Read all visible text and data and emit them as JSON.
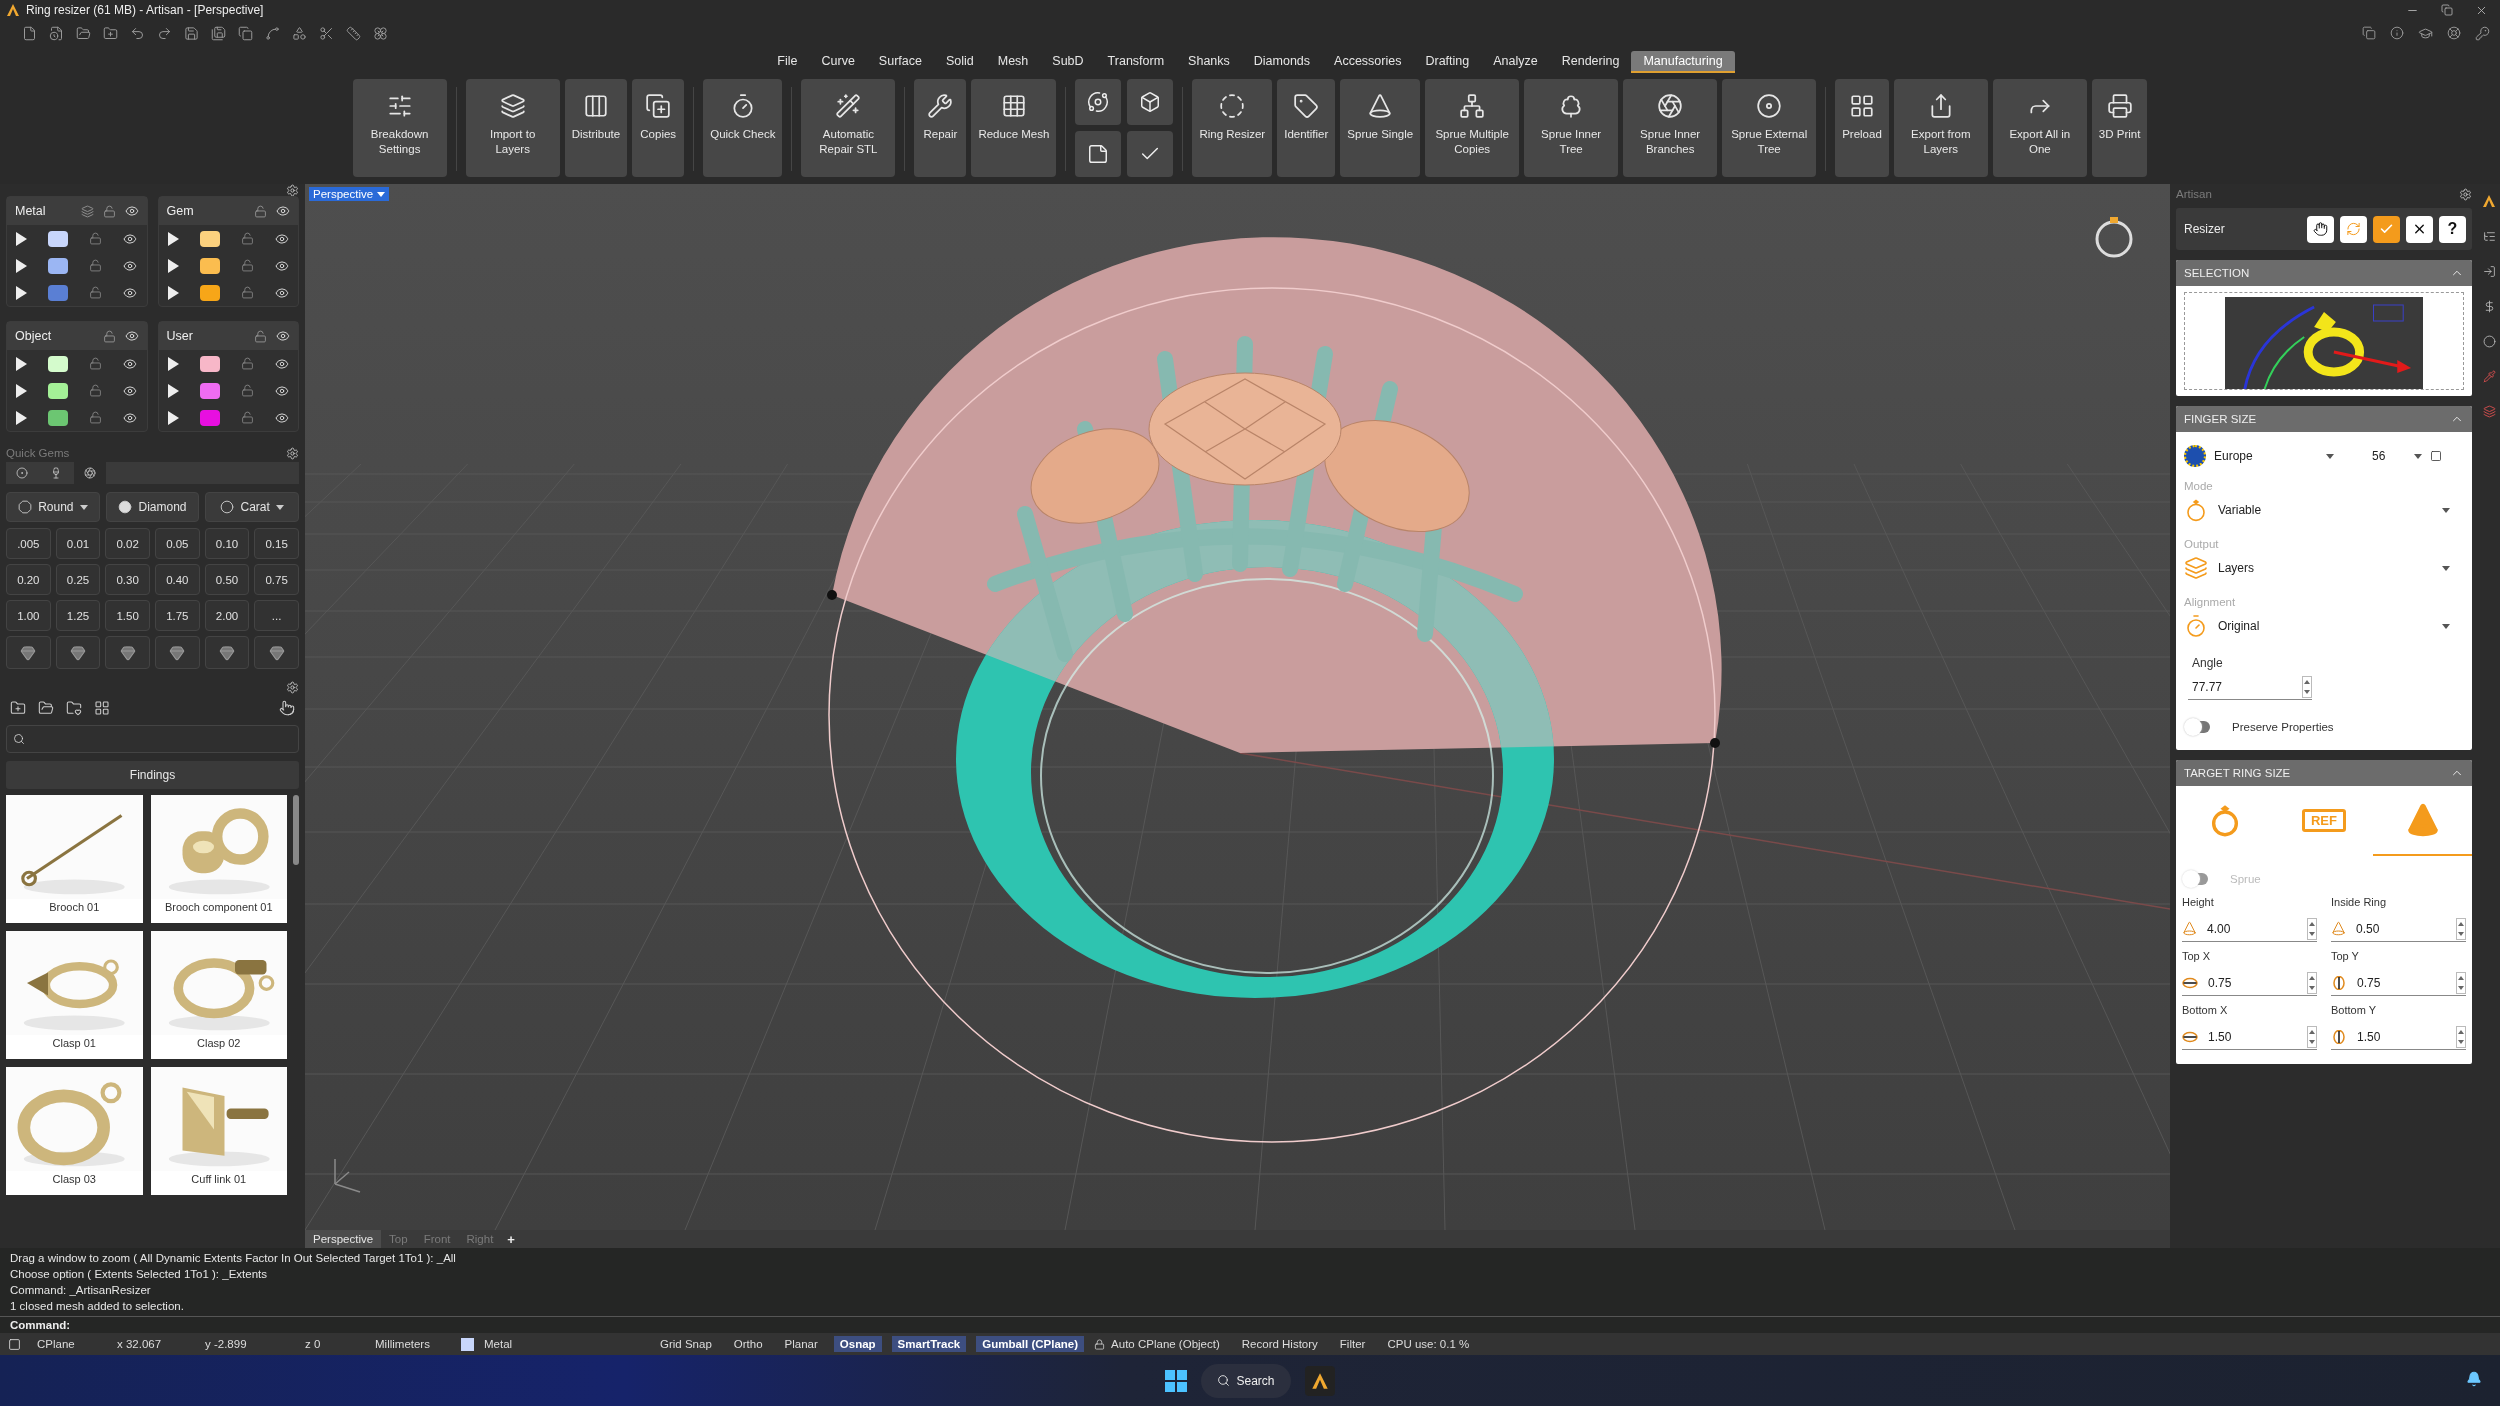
{
  "window": {
    "title": "Ring resizer (61 MB) - Artisan - [Perspective]"
  },
  "menu": [
    {
      "label": "File",
      "selected": false
    },
    {
      "label": "Curve",
      "selected": false
    },
    {
      "label": "Surface",
      "selected": false
    },
    {
      "label": "Solid",
      "selected": false
    },
    {
      "label": "Mesh",
      "selected": false
    },
    {
      "label": "SubD",
      "selected": false
    },
    {
      "label": "Transform",
      "selected": false
    },
    {
      "label": "Shanks",
      "selected": false
    },
    {
      "label": "Diamonds",
      "selected": false
    },
    {
      "label": "Accessories",
      "selected": false
    },
    {
      "label": "Drafting",
      "selected": false
    },
    {
      "label": "Analyze",
      "selected": false
    },
    {
      "label": "Rendering",
      "selected": false
    },
    {
      "label": "Manufacturing",
      "selected": true
    }
  ],
  "ribbon": {
    "groups": [
      {
        "kind": "large",
        "buttons": [
          "Breakdown Settings"
        ]
      },
      {
        "kind": "large",
        "buttons": [
          "Import to Layers",
          "Distribute",
          "Copies"
        ]
      },
      {
        "kind": "large",
        "buttons": [
          "Quick Check"
        ]
      },
      {
        "kind": "large",
        "buttons": [
          "Automatic Repair STL"
        ]
      },
      {
        "kind": "large",
        "buttons": [
          "Repair",
          "Reduce Mesh"
        ]
      },
      {
        "kind": "small"
      },
      {
        "kind": "large",
        "buttons": [
          "Ring Resizer",
          "Identifier",
          "Sprue Single",
          "Sprue Multiple Copies",
          "Sprue Inner Tree",
          "Sprue Inner Branches",
          "Sprue External Tree"
        ]
      },
      {
        "kind": "large",
        "buttons": [
          "Preload",
          "Export from Layers",
          "Export All in One",
          "3D Print"
        ]
      }
    ]
  },
  "layers": [
    {
      "name": "Metal",
      "swatches": [
        {
          "color": "#c8d6fb"
        },
        {
          "color": "#9bb6f3"
        },
        {
          "color": "#5a7fd4"
        }
      ]
    },
    {
      "name": "Gem",
      "swatches": [
        {
          "color": "#fcd17e"
        },
        {
          "color": "#fbbd4f"
        },
        {
          "color": "#f7a618"
        }
      ]
    },
    {
      "name": "Object",
      "swatches": [
        {
          "color": "#d4fbcc"
        },
        {
          "color": "#a4f197"
        },
        {
          "color": "#6cc672"
        }
      ]
    },
    {
      "name": "User",
      "swatches": [
        {
          "color": "#f7b7c8"
        },
        {
          "color": "#ef6cf2"
        },
        {
          "color": "#e80fe0"
        }
      ]
    }
  ],
  "quick_gems": {
    "title": "Quick Gems",
    "tabs": [
      {
        "selected": false
      },
      {
        "selected": false
      },
      {
        "selected": true
      }
    ],
    "dropdowns": [
      "Round",
      "Diamond",
      "Carat"
    ],
    "sizes": [
      ".005",
      "0.01",
      "0.02",
      "0.05",
      "0.10",
      "0.15",
      "0.20",
      "0.25",
      "0.30",
      "0.40",
      "0.50",
      "0.75",
      "1.00",
      "1.25",
      "1.50",
      "1.75",
      "2.00",
      "..."
    ]
  },
  "findings": {
    "category": "Findings",
    "items": [
      {
        "caption": "Brooch 01"
      },
      {
        "caption": "Brooch component 01"
      },
      {
        "caption": "Clasp 01"
      },
      {
        "caption": "Clasp 02"
      },
      {
        "caption": "Clasp 03"
      },
      {
        "caption": "Cuff link 01"
      }
    ]
  },
  "viewport": {
    "label": "Perspective",
    "tabs": [
      {
        "label": "Perspective",
        "selected": true
      },
      {
        "label": "Top",
        "selected": false
      },
      {
        "label": "Front",
        "selected": false
      },
      {
        "label": "Right",
        "selected": false
      }
    ],
    "add": "+"
  },
  "plugin": {
    "title": "Artisan",
    "tool": "Resizer",
    "help": "?"
  },
  "selection": {
    "title": "SELECTION"
  },
  "finger_size": {
    "title": "FINGER SIZE",
    "region": "Europe",
    "size": "56",
    "fields": [
      {
        "label": "Mode",
        "value": "Variable"
      },
      {
        "label": "Output",
        "value": "Layers"
      },
      {
        "label": "Alignment",
        "value": "Original"
      }
    ],
    "angle": {
      "label": "Angle",
      "value": "77.77"
    },
    "preserve_properties": {
      "label": "Preserve Properties",
      "on": false
    }
  },
  "target_ring_size": {
    "title": "TARGET RING SIZE",
    "tabs": [
      {
        "selected": false
      },
      {
        "label": "REF",
        "selected": false
      },
      {
        "selected": true
      }
    ],
    "sprue": {
      "label": "Sprue",
      "on": false,
      "disabled": true
    },
    "fields": [
      {
        "label": "Height",
        "value": "4.00"
      },
      {
        "label": "Inside Ring",
        "value": "0.50"
      },
      {
        "label": "Top X",
        "value": "0.75"
      },
      {
        "label": "Top Y",
        "value": "0.75"
      },
      {
        "label": "Bottom X",
        "value": "1.50"
      },
      {
        "label": "Bottom Y",
        "value": "1.50"
      }
    ]
  },
  "command_history": [
    "Drag a window to zoom ( All Dynamic Extents Factor In Out Selected Target 1To1 ): _All",
    "Choose option ( Extents Selected 1To1 ): _Extents",
    "Command: _ArtisanResizer",
    "1 closed mesh added to selection."
  ],
  "command_prompt": "Command:",
  "status_bar": {
    "cplane": "CPlane",
    "coords": [
      "x 32.067",
      "y -2.899",
      "z 0"
    ],
    "units": "Millimeters",
    "layer": {
      "name": "Metal",
      "color": "#c8d6fb"
    },
    "toggles": [
      {
        "label": "Grid Snap",
        "on": false
      },
      {
        "label": "Ortho",
        "on": false
      },
      {
        "label": "Planar",
        "on": false
      },
      {
        "label": "Osnap",
        "on": true
      },
      {
        "label": "SmartTrack",
        "on": true
      },
      {
        "label": "Gumball (CPlane)",
        "on": true
      }
    ],
    "extras": [
      "Auto CPlane (Object)",
      "Record History",
      "Filter"
    ],
    "cpu": "CPU use: 0.1 %"
  },
  "taskbar": {
    "search": "Search"
  }
}
